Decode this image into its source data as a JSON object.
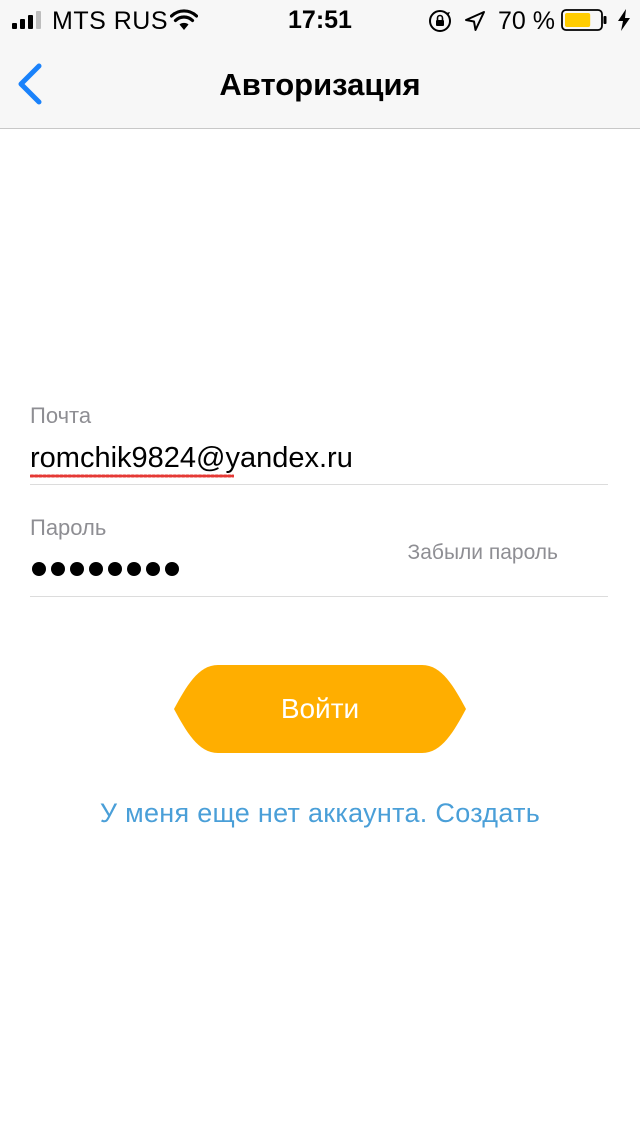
{
  "status_bar": {
    "carrier": "MTS RUS",
    "time": "17:51",
    "battery_percent": "70 %",
    "battery_level": 0.7,
    "battery_color": "#ffcc00",
    "icons": [
      "signal-icon",
      "wifi-icon",
      "orientation-lock-icon",
      "location-icon",
      "battery-icon",
      "charging-icon"
    ]
  },
  "nav": {
    "title": "Авторизация",
    "back_icon": "chevron-left-icon",
    "accent_color": "#1a82fb"
  },
  "form": {
    "email": {
      "label": "Почта",
      "value": "romchik9824@yandex.ru"
    },
    "password": {
      "label": "Пароль",
      "masked_length": 8,
      "forgot_label": "Забыли пароль"
    },
    "submit_label": "Войти",
    "submit_color": "#ffae00",
    "signup_link": "У меня еще нет аккаунта. Создать",
    "link_color": "#4a9fd8"
  }
}
